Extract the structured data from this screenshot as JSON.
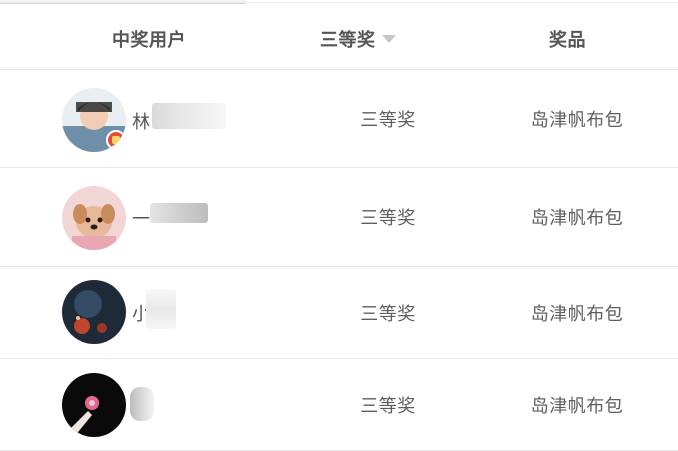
{
  "table": {
    "headers": {
      "user": "中奖用户",
      "tier": "三等奖",
      "prize": "奖品"
    },
    "rows": [
      {
        "user_name_visible": "林",
        "avatar": "boy-portrait-avatar",
        "tier": "三等奖",
        "prize": "岛津帆布包",
        "badge": "red-gift-badge"
      },
      {
        "user_name_visible": "一",
        "avatar": "puppy-avatar",
        "tier": "三等奖",
        "prize": "岛津帆布包"
      },
      {
        "user_name_visible": "小",
        "avatar": "dark-night-avatar",
        "tier": "三等奖",
        "prize": "岛津帆布包"
      },
      {
        "user_name_visible": "",
        "avatar": "hand-dark-avatar",
        "tier": "三等奖",
        "prize": "岛津帆布包"
      }
    ]
  },
  "colors": {
    "text": "#555555",
    "divider": "#e6e6e6",
    "sort_caret": "#c8c8c8",
    "badge": "#e84a3c"
  }
}
